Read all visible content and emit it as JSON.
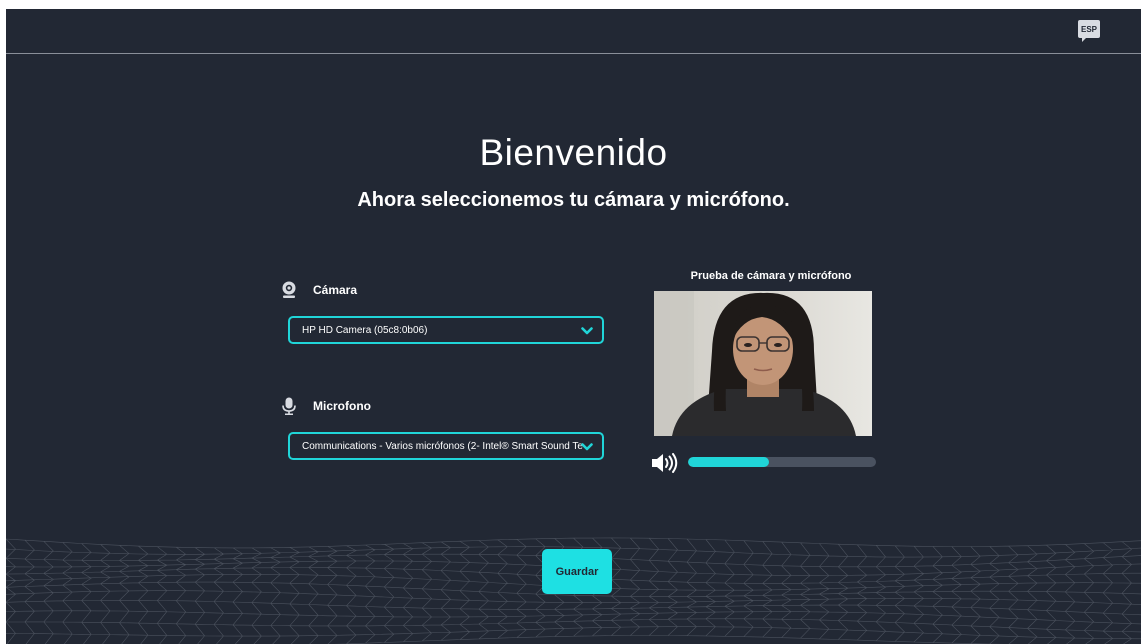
{
  "header": {
    "language_badge": "ESP"
  },
  "welcome": {
    "title": "Bienvenido",
    "subtitle": "Ahora seleccionemos tu cámara y micrófono."
  },
  "camera": {
    "label": "Cámara",
    "icon": "webcam-icon",
    "selected": "HP HD Camera (05c8:0b06)"
  },
  "microphone": {
    "label": "Microfono",
    "icon": "microphone-icon",
    "selected": "Communications - Varios micrófonos (2- Intel® Smart Sound Te"
  },
  "preview": {
    "title": "Prueba de cámara y micrófono",
    "volume_icon": "speaker-icon",
    "mic_level_percent": 43
  },
  "actions": {
    "save_label": "Guardar"
  },
  "colors": {
    "background": "#222834",
    "accent": "#20d5d8",
    "track": "#4a5260"
  }
}
